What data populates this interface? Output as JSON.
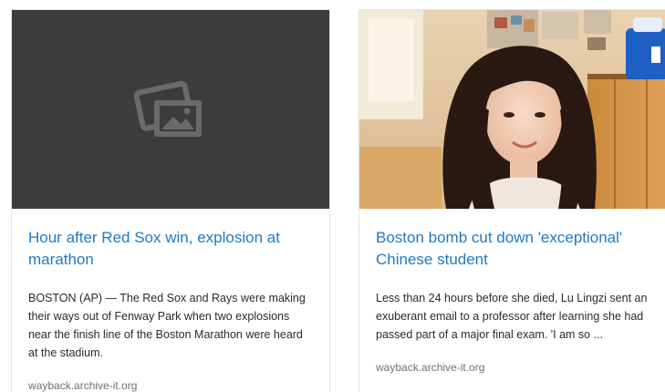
{
  "cards": [
    {
      "title": "Hour after Red Sox win, explosion at marathon",
      "snippet": "BOSTON (AP) — The Red Sox and Rays were making their ways out of Fenway Park when two explosions near the finish line of the Boston Marathon were heard at the stadium.",
      "source": "wayback.archive-it.org",
      "image": "image-placeholder-icon"
    },
    {
      "title": "Boston bomb cut down 'exceptional' Chinese student",
      "snippet": "Less than 24 hours before she died, Lu Lingzi sent an exuberant email to a professor after learning she had passed part of a major final exam. 'I am so ...",
      "source": "wayback.archive-it.org",
      "image": "portrait-photo"
    }
  ],
  "colors": {
    "title_link": "#1f7ac4",
    "snippet_text": "#2b2b2b",
    "source_text": "#707070",
    "placeholder_bg": "#3c3c3c",
    "card_border": "#e4e4e4"
  }
}
